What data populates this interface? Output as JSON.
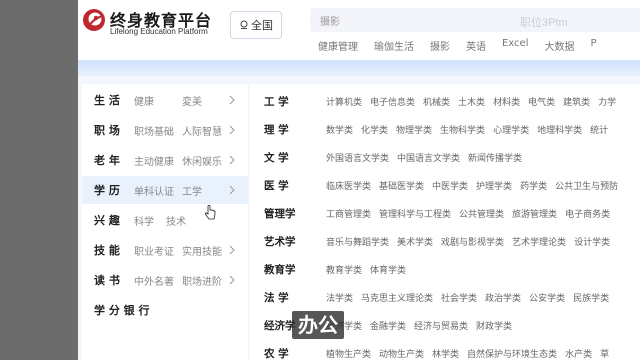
{
  "header": {
    "brand_cn": "终身教育平台",
    "brand_en": "Lifelong Education Platform",
    "region_label": "全国",
    "search_placeholder": "摄影",
    "search_ghost_text": "职位3Ptm",
    "hotwords": [
      "健康管理",
      "瑜伽生活",
      "摄影",
      "英语",
      "Excel",
      "大数据",
      "P"
    ]
  },
  "menu": [
    {
      "title": "生 活",
      "sub1": "健康",
      "sub2": "変美"
    },
    {
      "title": "职 场",
      "sub1": "职场基础",
      "sub2": "人际智慧"
    },
    {
      "title": "老 年",
      "sub1": "主动健康",
      "sub2": "休闲娱乐"
    },
    {
      "title": "学 历",
      "sub1": "单科认证",
      "sub2": "工学"
    },
    {
      "title": "兴 趣",
      "sub1": "科学",
      "sub2": "技术"
    },
    {
      "title": "技 能",
      "sub1": "职业考证",
      "sub2": "实用技能"
    },
    {
      "title": "读 书",
      "sub1": "中外名著",
      "sub2": "职场进阶"
    },
    {
      "title": "学 分 银 行",
      "sub1": "",
      "sub2": ""
    }
  ],
  "panel": [
    {
      "cat": "工 学",
      "items": [
        "计算机类",
        "电子信息类",
        "机械类",
        "土木类",
        "材料类",
        "电气类",
        "建筑类",
        "力学"
      ]
    },
    {
      "cat": "理 学",
      "items": [
        "数学类",
        "化学类",
        "物理学类",
        "生物科学类",
        "心理学类",
        "地理科学类",
        "统计"
      ]
    },
    {
      "cat": "文 学",
      "items": [
        "外国语言文学类",
        "中国语言文学类",
        "新闻传播学类"
      ]
    },
    {
      "cat": "医 学",
      "items": [
        "临床医学类",
        "基础医学类",
        "中医学类",
        "护理学类",
        "药学类",
        "公共卫生与预防"
      ]
    },
    {
      "cat": "管理学",
      "items": [
        "工商管理类",
        "管理科学与工程类",
        "公共管理类",
        "旅游管理类",
        "电子商务类"
      ]
    },
    {
      "cat": "艺术学",
      "items": [
        "音乐与舞蹈学类",
        "美术学类",
        "戏剧与影视学类",
        "艺术学理论类",
        "设计学类"
      ]
    },
    {
      "cat": "教育学",
      "items": [
        "教育学类",
        "体育学类"
      ]
    },
    {
      "cat": "法 学",
      "items": [
        "法学类",
        "马克思主义理论类",
        "社会学类",
        "政治学类",
        "公安学类",
        "民族学类"
      ]
    },
    {
      "cat": "经济学",
      "items": [
        "经济学类",
        "金融学类",
        "经济与贸易类",
        "财政学类"
      ]
    },
    {
      "cat": "农 学",
      "items": [
        "植物生产类",
        "动物生产类",
        "林学类",
        "自然保护与环境生态类",
        "水产类",
        "草"
      ]
    }
  ],
  "caption": "办公",
  "colors": {
    "accent": "#c0272d",
    "active_bg": "#e9f1fd",
    "band": "#cfe2fb"
  }
}
